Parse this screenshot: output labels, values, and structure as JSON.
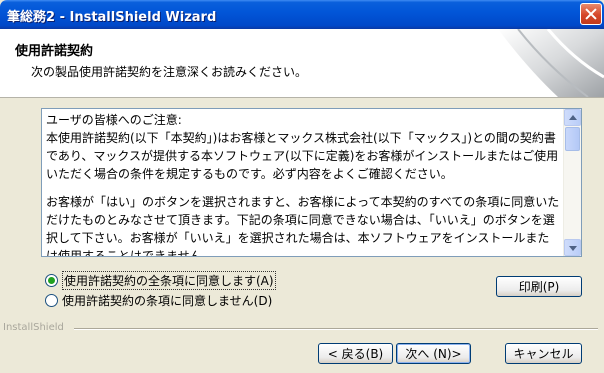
{
  "window": {
    "title": "筆総務2 - InstallShield Wizard"
  },
  "header": {
    "title": "使用許諾契約",
    "subtitle": "次の製品使用許諾契約を注意深くお読みください。"
  },
  "license": {
    "paragraphs": [
      "ユーザの皆様へのご注意:\n本使用許諾契約(以下「本契約」)はお客様とマックス株式会社(以下「マックス」)との間の契約書であり、マックスが提供する本ソフトウェア(以下に定義)をお客様がインストールまたはご使用いただく場合の条件を規定するものです。必ず内容をよくご確認ください。",
      "お客様が「はい」のボタンを選択されますと、お客様によって本契約のすべての条項に同意いただけたものとみなさせて頂きます。下記の条項に同意できない場合は、「いいえ」のボタンを選択して下さい。お客様が「いいえ」を選択された場合は、本ソフトウェアをインストールまたは使用することはできません。"
    ]
  },
  "options": {
    "accept_label": "使用許諾契約の全条項に同意します(A)",
    "decline_label": "使用許諾契約の条項に同意しません(D)",
    "selected": "accept"
  },
  "buttons": {
    "print": "印刷(P)",
    "back": "< 戻る(B)",
    "next": "次へ (N)>",
    "cancel": "キャンセル"
  },
  "footer": {
    "brand": "InstallShield"
  },
  "colors": {
    "titlebar": "#0256d8",
    "dialog_bg": "#ece9d8",
    "radio_selected": "#21a121",
    "close_button": "#d5462a"
  }
}
